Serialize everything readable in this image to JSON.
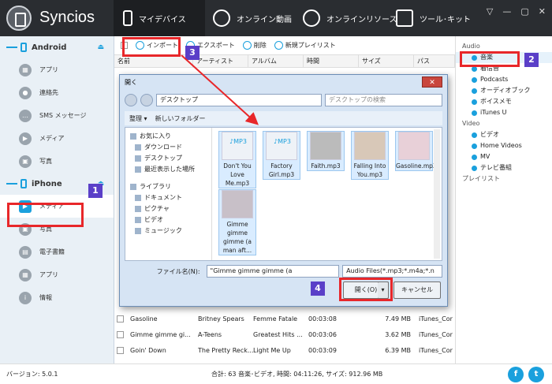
{
  "app": {
    "title": "Syncios",
    "version": "バージョン: 5.0.1"
  },
  "tabs": [
    {
      "label": "マイデバイス"
    },
    {
      "label": "オンライン動画"
    },
    {
      "label": "オンラインリソース"
    },
    {
      "label": "ツール･キット"
    }
  ],
  "window": {
    "minimize": "—",
    "maximize": "▢",
    "close": "✕",
    "menu": "▽"
  },
  "sidebar": {
    "android": {
      "title": "Android",
      "items": [
        "アプリ",
        "連絡先",
        "SMS メッセージ",
        "メディア",
        "写真"
      ]
    },
    "iphone": {
      "title": "iPhone",
      "items": [
        "メディア",
        "写真",
        "電子書籍",
        "アプリ",
        "情報"
      ]
    }
  },
  "toolbar": {
    "import": "インポート",
    "export": "エクスポート",
    "delete": "削除",
    "new_playlist": "新規プレイリスト"
  },
  "columns": [
    "名前",
    "アーティスト",
    "アルバム",
    "時間",
    "サイズ",
    "パス"
  ],
  "rows": [
    {
      "name": "Gasoline",
      "artist": "Britney Spears",
      "album": "Femme Fatale",
      "time": "00:03:08",
      "size": "7.49 MB",
      "path": "iTunes_Cor"
    },
    {
      "name": "Gimme gimme gi...",
      "artist": "A-Teens",
      "album": "Greatest Hits ...",
      "time": "00:03:06",
      "size": "3.62 MB",
      "path": "iTunes_Cor"
    },
    {
      "name": "Goin' Down",
      "artist": "The Pretty Reck...",
      "album": "Light Me Up",
      "time": "00:03:09",
      "size": "6.39 MB",
      "path": "iTunes_Cor"
    }
  ],
  "rightpane": {
    "audio": "Audio",
    "audio_items": [
      "音楽",
      "着信音",
      "Podcasts",
      "オーディオブック",
      "ボイスメモ",
      "iTunes U"
    ],
    "video": "Video",
    "video_items": [
      "ビデオ",
      "Home Videos",
      "MV",
      "テレビ番組"
    ],
    "playlist": "プレイリスト"
  },
  "status": {
    "summary": "合計: 63 音楽･ビデオ, 時間: 04:11:26, サイズ: 912.96 MB"
  },
  "social": {
    "facebook": "f",
    "twitter": "t"
  },
  "dialog": {
    "title": "開く",
    "close": "✕",
    "address": "デスクトップ",
    "search": "デスクトップの検索",
    "organize": "整理 ▾",
    "new_folder": "新しいフォルダー",
    "tree": [
      "お気に入り",
      "ダウンロード",
      "デスクトップ",
      "最近表示した場所",
      "ライブラリ",
      "ドキュメント",
      "ピクチャ",
      "ビデオ",
      "ミュージック"
    ],
    "files": [
      {
        "name": "Don't You Love Me.mp3"
      },
      {
        "name": "Factory Girl.mp3"
      },
      {
        "name": "Faith.mp3"
      },
      {
        "name": "Falling Into You.mp3"
      },
      {
        "name": "Gasoline.mp3"
      },
      {
        "name": "Gimme gimme gimme (a man aft..."
      }
    ],
    "filename_label": "ファイル名(N):",
    "filename_value": "\"Gimme gimme gimme (a",
    "filter": "Audio Files(*.mp3;*.m4a;*.n",
    "open": "開く(O)",
    "cancel": "キャンセル"
  },
  "callouts": [
    "1",
    "2",
    "3",
    "4"
  ],
  "colors": {
    "accent": "#1aa0dd",
    "highlight": "#e8272a",
    "badge": "#5a3fc8",
    "topbar": "#2a2d31"
  }
}
